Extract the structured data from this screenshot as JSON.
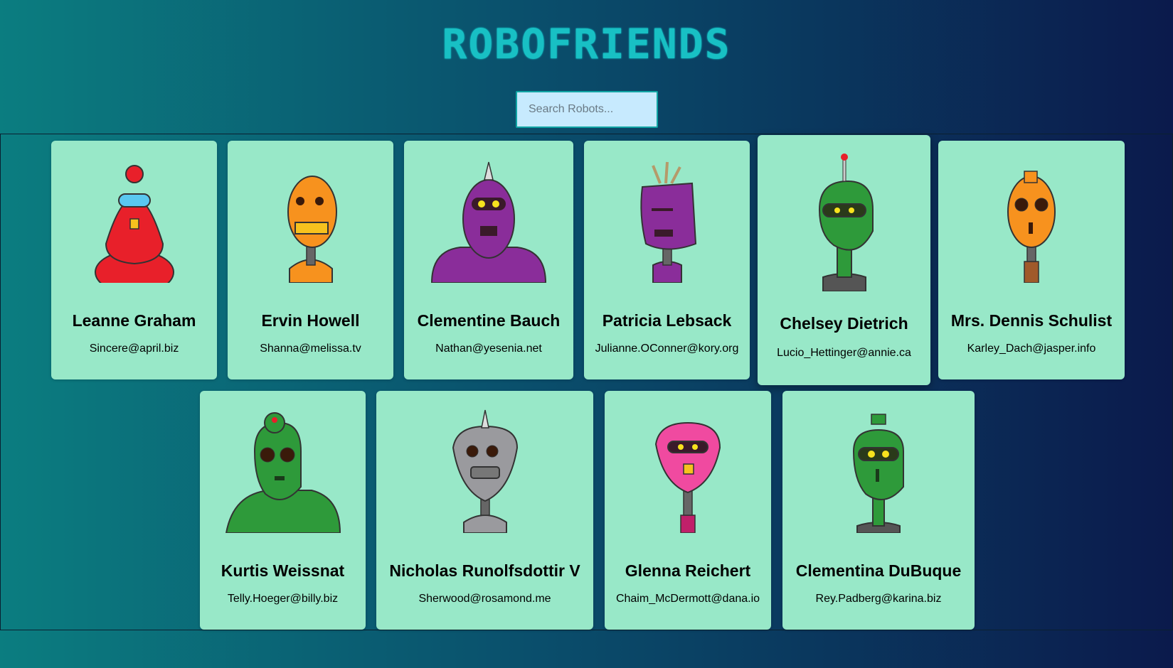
{
  "header": {
    "title": "ROBOFRIENDS"
  },
  "search": {
    "placeholder": "Search Robots..."
  },
  "robots": [
    {
      "name": "Leanne Graham",
      "email": "Sincere@april.biz",
      "color": "#e8202a"
    },
    {
      "name": "Ervin Howell",
      "email": "Shanna@melissa.tv",
      "color": "#f7921e"
    },
    {
      "name": "Clementine Bauch",
      "email": "Nathan@yesenia.net",
      "color": "#8a2d9a"
    },
    {
      "name": "Patricia Lebsack",
      "email": "Julianne.OConner@kory.org",
      "color": "#8a2d9a"
    },
    {
      "name": "Chelsey Dietrich",
      "email": "Lucio_Hettinger@annie.ca",
      "color": "#2e9a3a"
    },
    {
      "name": "Mrs. Dennis Schulist",
      "email": "Karley_Dach@jasper.info",
      "color": "#f7921e"
    },
    {
      "name": "Kurtis Weissnat",
      "email": "Telly.Hoeger@billy.biz",
      "color": "#2e9a3a"
    },
    {
      "name": "Nicholas Runolfsdottir V",
      "email": "Sherwood@rosamond.me",
      "color": "#9a9a9e"
    },
    {
      "name": "Glenna Reichert",
      "email": "Chaim_McDermott@dana.io",
      "color": "#f04aa0"
    },
    {
      "name": "Clementina DuBuque",
      "email": "Rey.Padberg@karina.biz",
      "color": "#2e9a3a"
    }
  ]
}
